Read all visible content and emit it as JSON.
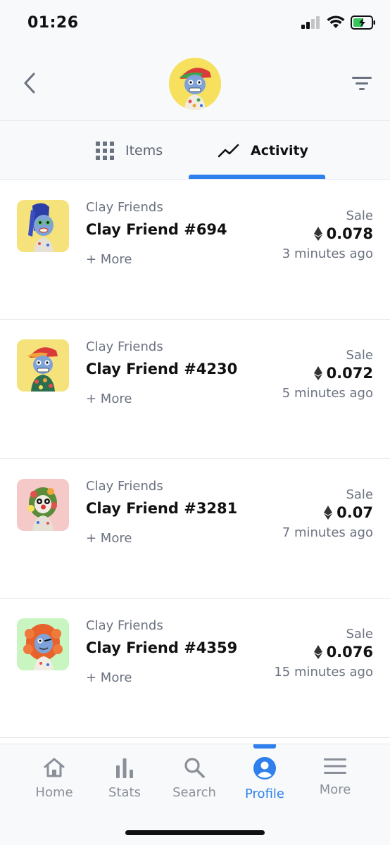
{
  "status_bar": {
    "time": "01:26",
    "icons": [
      "signal-icon",
      "wifi-icon",
      "battery-charging-icon"
    ]
  },
  "header": {
    "back_icon": "chevron-left-icon",
    "filter_icon": "filter-icon",
    "avatar_color": "#f6e05e"
  },
  "tabs": [
    {
      "label": "Items",
      "icon": "grid-icon",
      "active": false
    },
    {
      "label": "Activity",
      "icon": "trend-line-icon",
      "active": true
    }
  ],
  "activity": [
    {
      "collection": "Clay Friends",
      "name": "Clay Friend #694",
      "more": "+ More",
      "event": "Sale",
      "price": "0.078",
      "time": "3 minutes ago",
      "bg": "#f6e27a"
    },
    {
      "collection": "Clay Friends",
      "name": "Clay Friend #4230",
      "more": "+ More",
      "event": "Sale",
      "price": "0.072",
      "time": "5 minutes ago",
      "bg": "#f6e27a"
    },
    {
      "collection": "Clay Friends",
      "name": "Clay Friend #3281",
      "more": "+ More",
      "event": "Sale",
      "price": "0.07",
      "time": "7 minutes ago",
      "bg": "#f6c9c9"
    },
    {
      "collection": "Clay Friends",
      "name": "Clay Friend #4359",
      "more": "+ More",
      "event": "Sale",
      "price": "0.076",
      "time": "15 minutes ago",
      "bg": "#c9f5c0"
    }
  ],
  "nav": [
    {
      "label": "Home",
      "icon": "home-icon",
      "active": false
    },
    {
      "label": "Stats",
      "icon": "bar-chart-icon",
      "active": false
    },
    {
      "label": "Search",
      "icon": "search-icon",
      "active": false
    },
    {
      "label": "Profile",
      "icon": "profile-icon",
      "active": true
    },
    {
      "label": "More",
      "icon": "menu-icon",
      "active": false
    }
  ],
  "colors": {
    "accent": "#2f80ed",
    "muted": "#6b7280",
    "background": "#f8f9fb"
  }
}
